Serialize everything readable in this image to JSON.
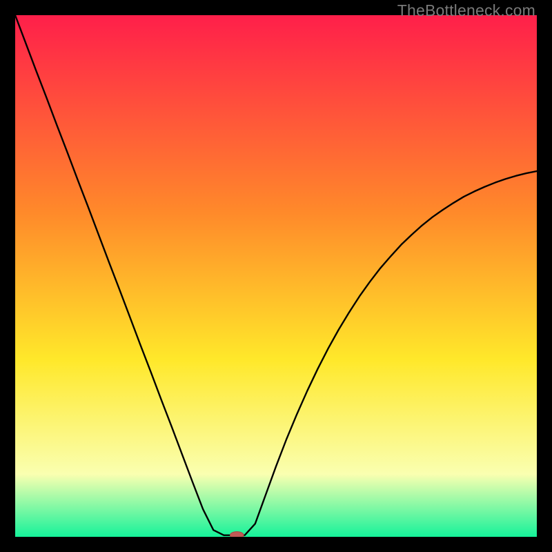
{
  "watermark": "TheBottleneck.com",
  "colors": {
    "top": "#ff1f4a",
    "mid_upper": "#ff8a2a",
    "mid": "#ffe82a",
    "mid_lower": "#faffb0",
    "bottom": "#15f29a",
    "curve": "#000000",
    "marker_fill": "#c05a56",
    "marker_stroke": "#a84844"
  },
  "chart_data": {
    "type": "line",
    "title": "",
    "xlabel": "",
    "ylabel": "",
    "xlim": [
      0,
      100
    ],
    "ylim": [
      0,
      100
    ],
    "x": [
      0,
      2,
      4,
      6,
      8,
      10,
      12,
      14,
      16,
      18,
      20,
      22,
      24,
      26,
      28,
      30,
      32,
      34,
      36,
      38,
      40,
      42,
      44,
      46,
      48,
      50,
      52,
      54,
      56,
      58,
      60,
      62,
      64,
      66,
      68,
      70,
      72,
      74,
      76,
      78,
      80,
      82,
      84,
      86,
      88,
      90,
      92,
      94,
      96,
      98,
      100
    ],
    "values": [
      100,
      94.7,
      89.4,
      84.2,
      78.9,
      73.7,
      68.4,
      63.2,
      57.9,
      52.6,
      47.4,
      42.1,
      36.8,
      31.6,
      26.3,
      21.1,
      15.8,
      10.5,
      5.3,
      1.3,
      0.3,
      0.3,
      0.3,
      2.5,
      8.0,
      13.5,
      18.7,
      23.5,
      28.0,
      32.2,
      36.1,
      39.7,
      43.0,
      46.1,
      48.9,
      51.5,
      53.8,
      56.0,
      57.9,
      59.7,
      61.3,
      62.7,
      64.0,
      65.2,
      66.2,
      67.1,
      67.9,
      68.6,
      69.2,
      69.7,
      70.1
    ],
    "marker": {
      "x": 42.5,
      "y": 0.3,
      "rx": 1.3,
      "ry": 0.7
    },
    "series": [],
    "categories": []
  }
}
